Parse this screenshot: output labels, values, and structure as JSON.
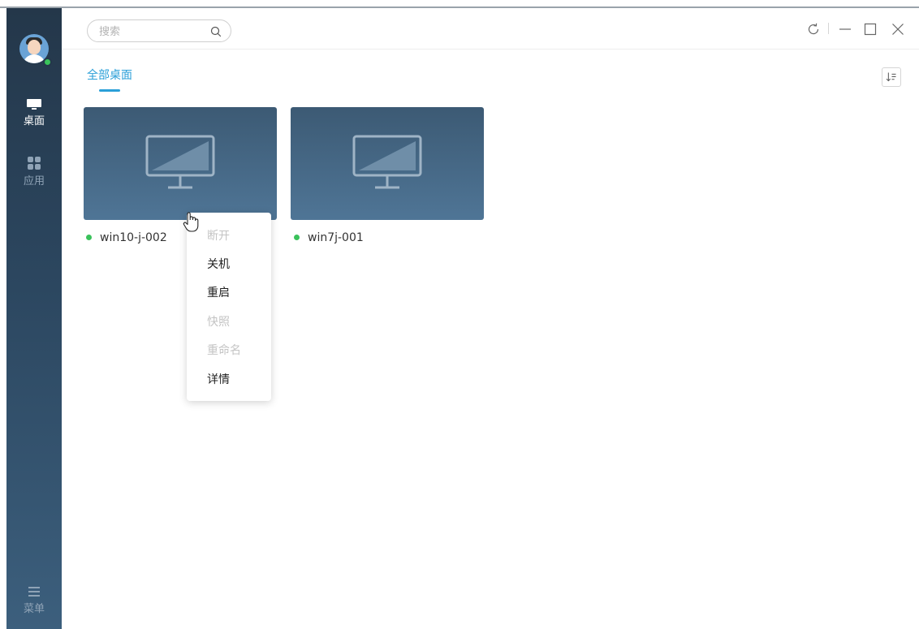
{
  "sidebar": {
    "user_status": "online",
    "items": [
      {
        "label": "桌面",
        "icon": "monitor-icon",
        "active": true
      },
      {
        "label": "应用",
        "icon": "apps-grid-icon",
        "active": false
      }
    ],
    "menu_label": "菜单",
    "menu_icon": "hamburger-icon"
  },
  "header": {
    "search_placeholder": "搜索",
    "controls": [
      "refresh-icon",
      "minimize-icon",
      "maximize-icon",
      "close-icon"
    ]
  },
  "tabs": [
    {
      "label": "全部桌面",
      "active": true
    }
  ],
  "desktops": [
    {
      "name": "win10-j-002",
      "status": "online"
    },
    {
      "name": "win7j-001",
      "status": "online"
    }
  ],
  "context_menu": {
    "items": [
      {
        "label": "断开",
        "enabled": false
      },
      {
        "label": "关机",
        "enabled": true
      },
      {
        "label": "重启",
        "enabled": true
      },
      {
        "label": "快照",
        "enabled": false
      },
      {
        "label": "重命名",
        "enabled": false
      },
      {
        "label": "详情",
        "enabled": true
      }
    ]
  },
  "colors": {
    "accent": "#2a9fd8",
    "sidebar_top": "#24374a",
    "sidebar_bottom": "#3c5f7d",
    "online": "#3ac25b",
    "card": "#4a6d8c"
  }
}
